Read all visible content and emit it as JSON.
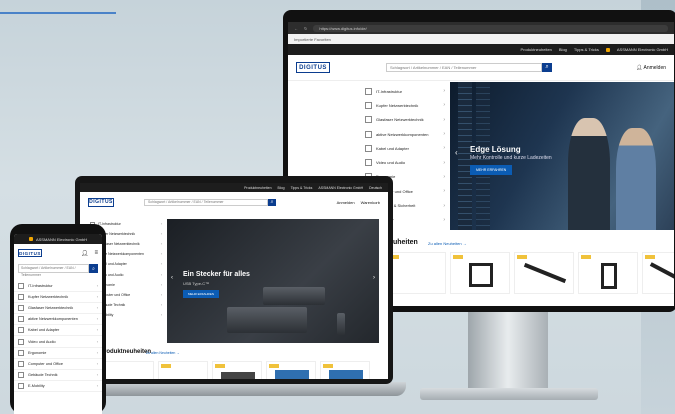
{
  "monitor": {
    "browser_url": "https://www.digitus.info/de/",
    "bookmark_label": "Importierte Favoriten",
    "topbar": [
      "Produktneuheiten",
      "Blog",
      "Tipps & Tricks",
      "ASSMANN Electronic GmbH"
    ],
    "logo": "DIGITUS",
    "search_placeholder": "Schlagwort / Artikelnummer / EAN / Teilenummer",
    "login_label": "Anmelden",
    "categories": [
      "IT-Infrastruktur",
      "Kupfer Netzwerktechnik",
      "Glasfaser Netzwerktechnik",
      "aktive Netzwerkkomponenten",
      "Kabel und Adapter",
      "Video und Audio",
      "Ergonomie",
      "Computer und Office",
      "Netzwerk & Sicherheit",
      "E-Mobility"
    ],
    "hero": {
      "title": "Edge Lösung",
      "subtitle": "Mehr Kontrolle und kurze Ladezeiten",
      "button": "MEHR ERFAHREN"
    },
    "news_heading": "Neuheiten",
    "news_link": "Zu allen Neuheiten →"
  },
  "laptop": {
    "topbar": [
      "Produktneuheiten",
      "Blog",
      "Tipps & Tricks",
      "ASSMANN Electronic GmbH",
      "Deutsch"
    ],
    "logo": "DIGITUS",
    "search_placeholder": "Schlagwort / Artikelnummer / EAN / Teilenummer",
    "login_label": "Anmelden",
    "cart_label": "Warenkorb",
    "categories": [
      "IT-Infrastruktur",
      "Kupfer Netzwerktechnik",
      "Glasfaser Netzwerktechnik",
      "aktive Netzwerkkomponenten",
      "Kabel und Adapter",
      "Video und Audio",
      "Ergonomie",
      "Computer und Office",
      "Gebäude Technik",
      "E-Mobility"
    ],
    "hero": {
      "title": "Ein Stecker für alles",
      "subtitle": "USB Type-C™",
      "button": "MEHR ERFAHREN"
    },
    "news_heading": "Produktneuheiten",
    "news_link": "Zu allen Neuheiten →"
  },
  "phone": {
    "topbar": "ASSMANN Electronic GmbH",
    "logo": "DIGITUS",
    "search_placeholder": "Schlagwort / Artikelnummer / EAN / Teilenummer",
    "categories": [
      "IT-Infrastruktur",
      "Kupfer Netzwerktechnik",
      "Glasfaser Netzwerktechnik",
      "aktive Netzwerkkomponenten",
      "Kabel und Adapter",
      "Video und Audio",
      "Ergonomie",
      "Computer und Office",
      "Gebäude Technik",
      "E-Mobility"
    ]
  },
  "colors": {
    "brand": "#0b3d8f",
    "button": "#0b5cb4",
    "badge": "#f0c23b",
    "topbar": "#1d1d1d",
    "accent_line": "#4a82c8"
  }
}
